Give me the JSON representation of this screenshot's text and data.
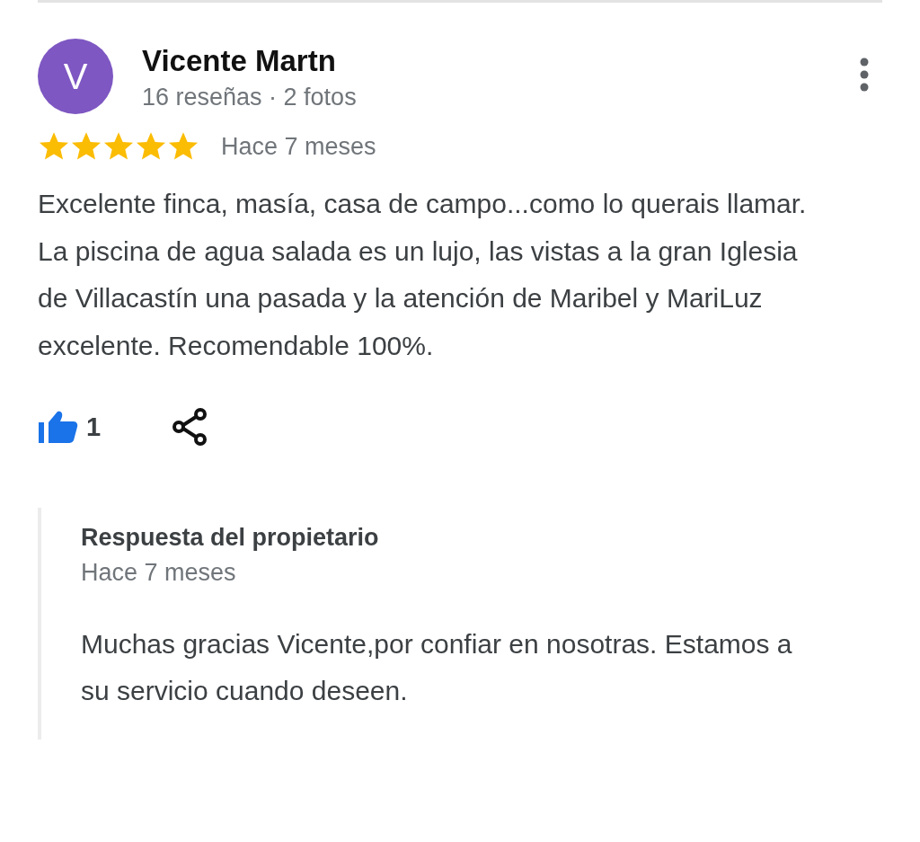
{
  "review": {
    "avatar_letter": "V",
    "author": "Vicente Martn",
    "author_meta": "16 reseñas · 2 fotos",
    "stars": 5,
    "time": "Hace 7 meses",
    "text": "Excelente finca, masía, casa de campo...como lo querais llamar. La piscina de agua salada es un lujo, las vistas a la gran Iglesia de Villacastín una pasada y la atención de Maribel y MariLuz excelente. Recomendable 100%.",
    "likes": "1",
    "liked": true
  },
  "owner_reply": {
    "title": "Respuesta del propietario",
    "time": "Hace 7 meses",
    "text": "Muchas gracias Vicente,por confiar en nosotras. Estamos a su servicio cuando deseen."
  }
}
